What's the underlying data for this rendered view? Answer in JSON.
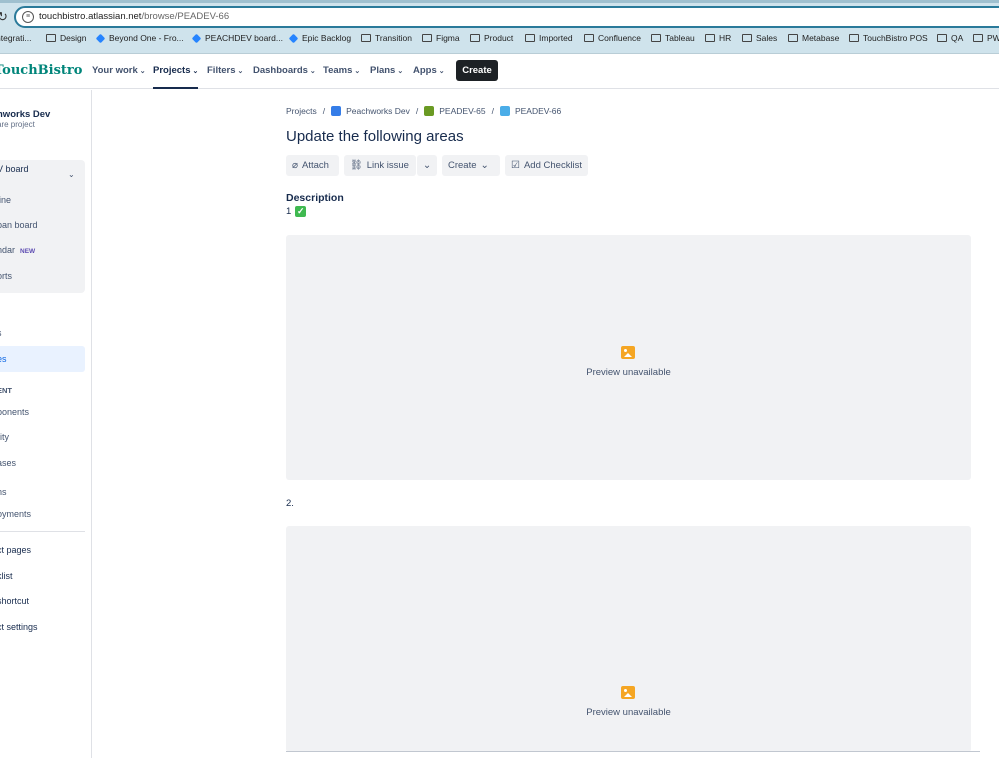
{
  "browser": {
    "url_host": "touchbistro.atlassian.net",
    "url_path": "/browse/PEADEV-66",
    "bookmarks": [
      {
        "label": "ntegrati...",
        "icon": "folder-icon"
      },
      {
        "label": "Design",
        "icon": "folder-icon"
      },
      {
        "label": "Beyond One - Fro...",
        "icon": "jira-icon"
      },
      {
        "label": "PEACHDEV board...",
        "icon": "jira-icon"
      },
      {
        "label": "Epic Backlog",
        "icon": "jira-icon"
      },
      {
        "label": "Transition",
        "icon": "folder-icon"
      },
      {
        "label": "Figma",
        "icon": "folder-icon"
      },
      {
        "label": "Product",
        "icon": "folder-icon"
      },
      {
        "label": "Imported",
        "icon": "folder-icon"
      },
      {
        "label": "Confluence",
        "icon": "folder-icon"
      },
      {
        "label": "Tableau",
        "icon": "folder-icon"
      },
      {
        "label": "HR",
        "icon": "folder-icon"
      },
      {
        "label": "Sales",
        "icon": "folder-icon"
      },
      {
        "label": "Metabase",
        "icon": "folder-icon"
      },
      {
        "label": "TouchBistro POS",
        "icon": "folder-icon"
      },
      {
        "label": "QA",
        "icon": "folder-icon"
      },
      {
        "label": "PW",
        "icon": "folder-icon"
      }
    ]
  },
  "topnav": {
    "logo": "TouchBistro",
    "items": [
      "Your work",
      "Projects",
      "Filters",
      "Dashboards",
      "Teams",
      "Plans",
      "Apps"
    ],
    "create_label": "Create"
  },
  "sidebar": {
    "project_name": "nworks Dev",
    "project_type": "are project",
    "board_label": "V board",
    "board_items": [
      "line",
      "pan board",
      "ndar",
      "orts"
    ],
    "new_badge": "NEW",
    "items_a": [
      "s",
      "es"
    ],
    "section_label": "ENT",
    "items_b": [
      "ponents",
      "rity",
      "ases"
    ],
    "items_c": [
      "ns",
      "oyments"
    ],
    "items_d": [
      "ct pages",
      "klist",
      "shortcut",
      "ct settings"
    ]
  },
  "issue": {
    "breadcrumbs": [
      "Projects",
      "Peachworks Dev",
      "PEADEV-65",
      "PEADEV-66"
    ],
    "title": "Update the following areas",
    "toolbar": {
      "attach": "Attach",
      "link_issue": "Link issue",
      "create": "Create",
      "add_checklist": "Add Checklist"
    },
    "description_label": "Description",
    "line1": "1",
    "line2": "2.",
    "preview_text": "Preview unavailable"
  }
}
